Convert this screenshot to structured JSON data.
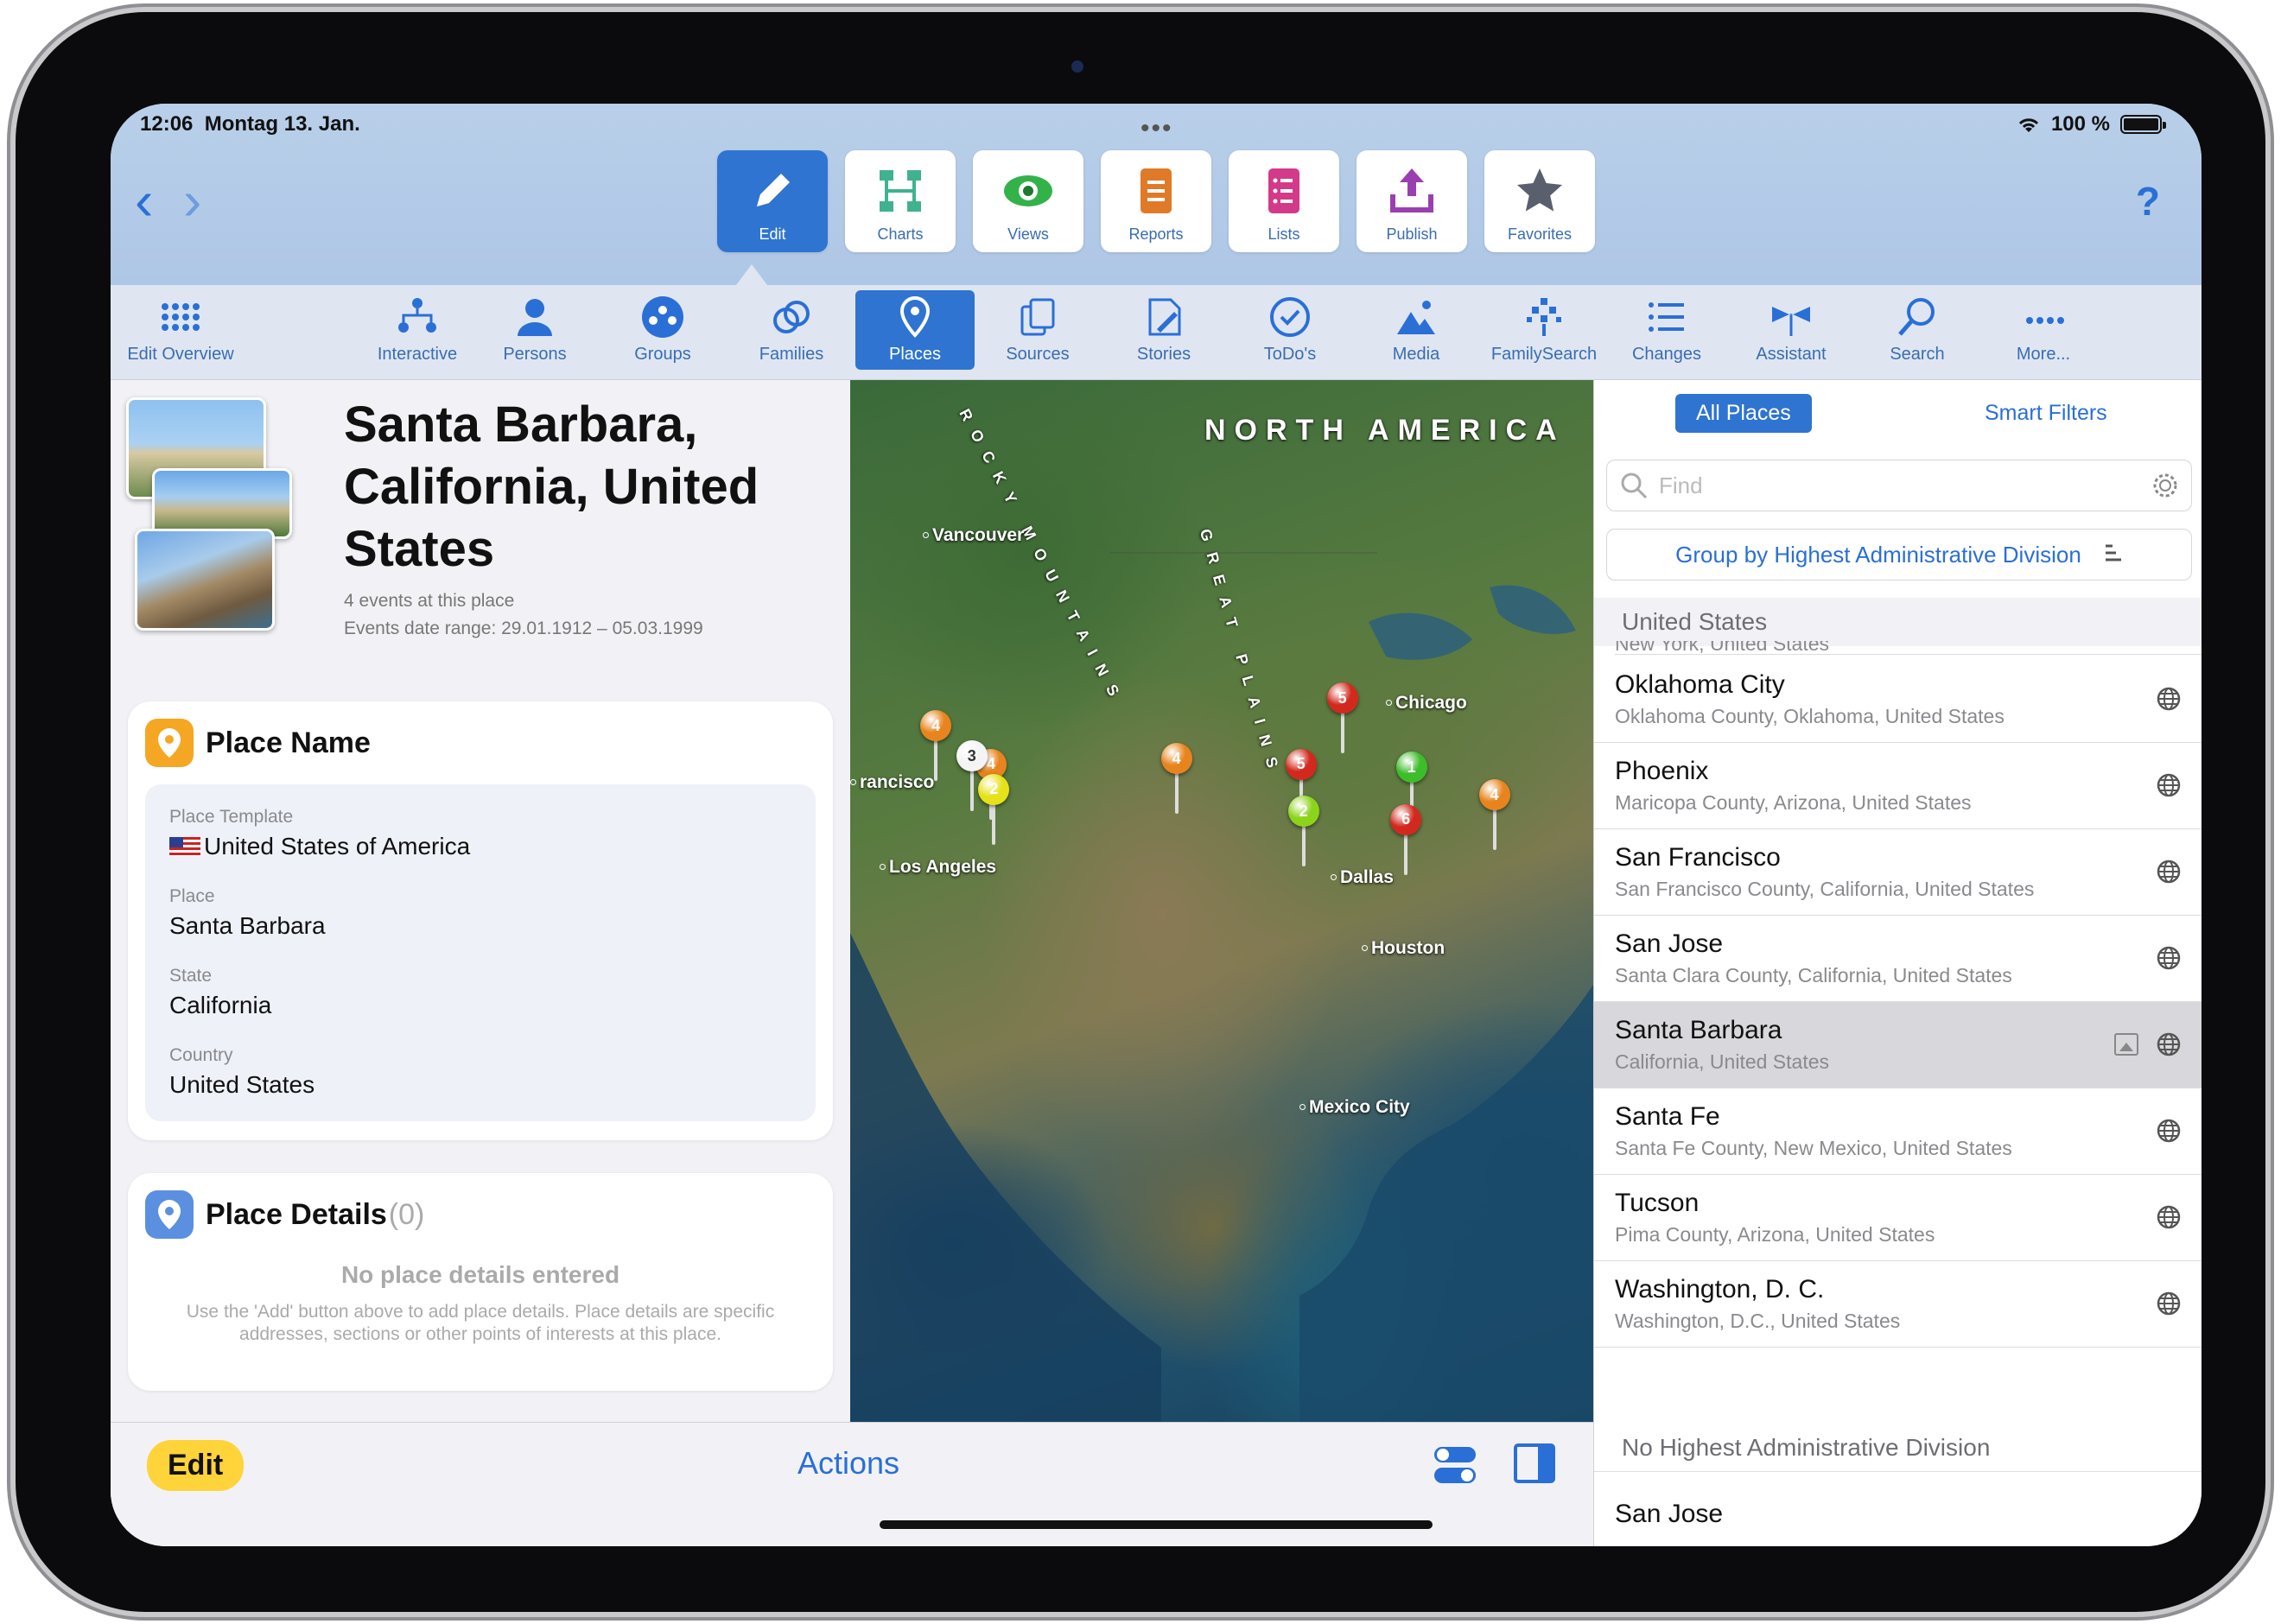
{
  "status": {
    "time": "12:06",
    "date": "Montag 13. Jan.",
    "battery": "100 %"
  },
  "nav": {
    "back": "‹",
    "forward": "›",
    "help": "?"
  },
  "toolbar": [
    {
      "label": "Edit",
      "icon": "pencil-icon",
      "active": true
    },
    {
      "label": "Charts",
      "icon": "tree-chart-icon"
    },
    {
      "label": "Views",
      "icon": "eye-icon"
    },
    {
      "label": "Reports",
      "icon": "report-icon"
    },
    {
      "label": "Lists",
      "icon": "list-icon"
    },
    {
      "label": "Publish",
      "icon": "upload-icon"
    },
    {
      "label": "Favorites",
      "icon": "star-icon"
    }
  ],
  "subbar": [
    {
      "label": "Edit Overview"
    },
    {
      "label": "Interactive"
    },
    {
      "label": "Persons"
    },
    {
      "label": "Groups"
    },
    {
      "label": "Families"
    },
    {
      "label": "Places",
      "active": true
    },
    {
      "label": "Sources"
    },
    {
      "label": "Stories"
    },
    {
      "label": "ToDo's"
    },
    {
      "label": "Media"
    },
    {
      "label": "FamilySearch"
    },
    {
      "label": "Changes"
    },
    {
      "label": "Assistant"
    },
    {
      "label": "Search"
    },
    {
      "label": "More..."
    }
  ],
  "place": {
    "title": "Santa Barbara, California, United States",
    "events": "4 events at this place",
    "date_range": "Events date range: 29.01.1912 – 05.03.1999"
  },
  "place_name_card": {
    "title": "Place Name",
    "template_label": "Place Template",
    "template_value": "United States of America",
    "place_label": "Place",
    "place_value": "Santa Barbara",
    "state_label": "State",
    "state_value": "California",
    "country_label": "Country",
    "country_value": "United States"
  },
  "place_details_card": {
    "title": "Place Details",
    "count": "(0)",
    "empty_title": "No place details entered",
    "empty_body": "Use the 'Add' button above to add place details. Place details are specific addresses, sections or other points of interests at this place."
  },
  "bottom": {
    "edit": "Edit",
    "actions": "Actions"
  },
  "map": {
    "region": "NORTH AMERICA",
    "mountains_1": "ROCKY MOUNTAINS",
    "mountains_2": "GREAT PLAINS",
    "cities": [
      "Vancouver",
      "rancisco",
      "Los Angeles",
      "Chicago",
      "Dallas",
      "Houston",
      "Mexico City"
    ],
    "pins": [
      "4",
      "4",
      "3",
      "2",
      "4",
      "5",
      "5",
      "1",
      "2",
      "6",
      "4"
    ]
  },
  "sidebar": {
    "tab_all": "All Places",
    "tab_smart": "Smart Filters",
    "find_placeholder": "Find",
    "group_by": "Group by Highest Administrative Division",
    "section_us": "United States",
    "partial": "New York, United States",
    "rows": [
      {
        "name": "Oklahoma City",
        "sub": "Oklahoma County, Oklahoma, United States"
      },
      {
        "name": "Phoenix",
        "sub": "Maricopa County, Arizona, United States"
      },
      {
        "name": "San Francisco",
        "sub": "San Francisco County, California, United States"
      },
      {
        "name": "San Jose",
        "sub": "Santa Clara County, California, United States"
      },
      {
        "name": "Santa Barbara",
        "sub": "California, United States",
        "selected": true
      },
      {
        "name": "Santa Fe",
        "sub": "Santa Fe County, New Mexico, United States"
      },
      {
        "name": "Tucson",
        "sub": "Pima County, Arizona, United States"
      },
      {
        "name": "Washington, D. C.",
        "sub": "Washington, D.C., United States"
      }
    ],
    "section_none": "No Highest Administrative Division",
    "last_row": "San Jose"
  },
  "colors": {
    "accent": "#2f74d0",
    "edit_pill": "#ffd33a"
  }
}
